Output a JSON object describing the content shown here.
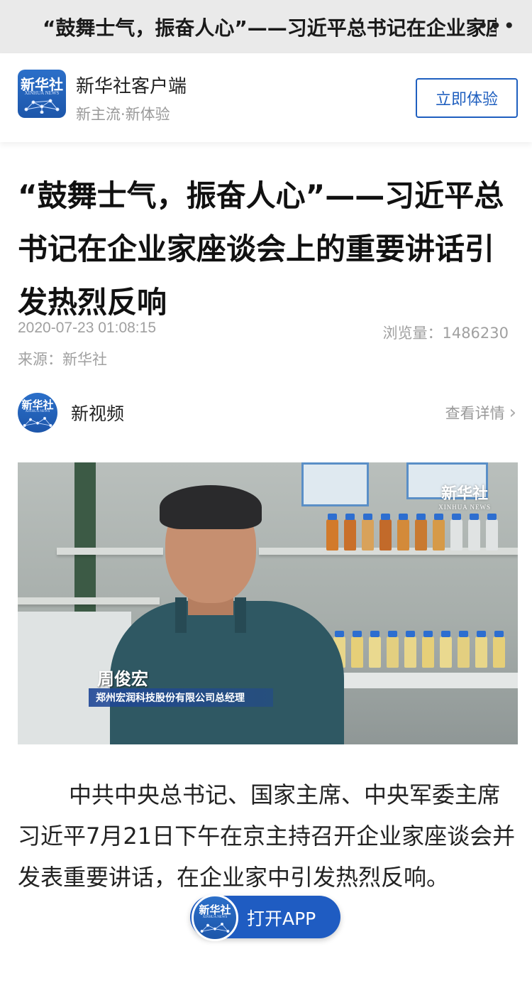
{
  "topbar": {
    "title": "“鼓舞士气，振奋人心”——习近平总书记在企业家座…",
    "more_icon": "more-horizontal-icon"
  },
  "promo": {
    "logo_cn": "新华社",
    "logo_en": "XINHUA NEWS",
    "app_name": "新华社客户端",
    "slogan": "新主流·新体验",
    "cta_label": "立即体验"
  },
  "article": {
    "headline": "“鼓舞士气，振奋人心”——习近平总书记在企业家座谈会上的重要讲话引发热烈反响",
    "publish_time": "2020-07-23 01:08:15",
    "views": "浏览量：1486230",
    "source": "来源：新华社"
  },
  "channel": {
    "logo_cn": "新华社",
    "logo_en": "XINHUA NEWS",
    "name": "新视频",
    "detail_label": "查看详情"
  },
  "video": {
    "watermark_cn": "新华社",
    "watermark_en": "XINHUA NEWS",
    "speaker_name": "周俊宏",
    "speaker_title": "郑州宏润科技股份有限公司总经理"
  },
  "body": {
    "paragraph": "中共中央总书记、国家主席、中央军委主席习近平7月21日下午在京主持召开企业家座谈会并发表重要讲话，在企业家中引发热烈反响。"
  },
  "open_app": {
    "logo_cn": "新华社",
    "logo_en": "XINHUA NEWS",
    "label": "打开APP"
  },
  "colors": {
    "brand_blue": "#1f5cc2",
    "topbar_bg": "#eaeaea",
    "meta_gray": "#a0a0a0"
  }
}
